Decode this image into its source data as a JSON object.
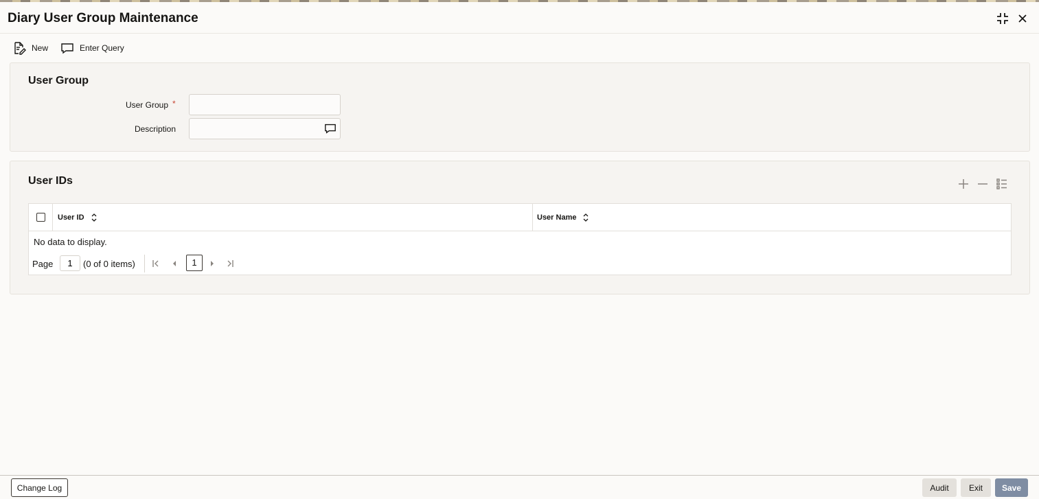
{
  "window": {
    "title": "Diary User Group Maintenance",
    "maximize_icon": "collapse-arrows-icon",
    "close_icon": "close-icon"
  },
  "toolbar": {
    "new_label": "New",
    "new_icon": "document-edit-icon",
    "enter_query_label": "Enter Query",
    "enter_query_icon": "speech-bubble-icon"
  },
  "user_group_section": {
    "title": "User Group",
    "fields": {
      "user_group": {
        "label": "User Group",
        "required_marker": "*",
        "value": "",
        "placeholder": ""
      },
      "description": {
        "label": "Description",
        "value": "",
        "placeholder": "",
        "icon": "speech-bubble-icon"
      }
    }
  },
  "user_ids_section": {
    "title": "User IDs",
    "actions": {
      "add_icon": "plus-icon",
      "remove_icon": "minus-icon",
      "columns_icon": "list-settings-icon"
    },
    "table": {
      "columns": [
        "User ID",
        "User Name"
      ],
      "rows": [],
      "empty_message": "No data to display."
    },
    "pagination": {
      "page_label": "Page",
      "page_value": "1",
      "items_text": "(0 of 0 items)",
      "current_page": "1"
    }
  },
  "footer": {
    "change_log_label": "Change Log",
    "audit_label": "Audit",
    "exit_label": "Exit",
    "save_label": "Save"
  },
  "colors": {
    "required": "#c74634",
    "primary_button": "#7f8da3",
    "panel_bg": "#f6f4f1"
  }
}
